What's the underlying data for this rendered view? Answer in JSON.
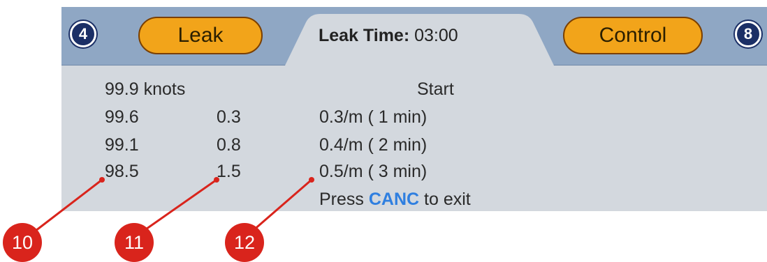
{
  "header": {
    "left_badge": "4",
    "right_badge": "8",
    "left_button": "Leak",
    "right_button": "Control",
    "leak_time_label": "Leak Time:",
    "leak_time_value": "03:00"
  },
  "rows": [
    {
      "speed": "99.9 knots",
      "diff": "",
      "rate": "Start"
    },
    {
      "speed": "99.6",
      "diff": "0.3",
      "rate": "0.3/m ( 1 min)"
    },
    {
      "speed": "99.1",
      "diff": "0.8",
      "rate": "0.4/m ( 2 min)"
    },
    {
      "speed": "98.5",
      "diff": "1.5",
      "rate": "0.5/m ( 3 min)"
    }
  ],
  "footer": {
    "prefix": "Press",
    "key": "CANC",
    "suffix": "to exit"
  },
  "callouts": [
    "10",
    "11",
    "12"
  ],
  "colors": {
    "header_band": "#8fa7c4",
    "panel": "#d3d8de",
    "button_fill": "#f2a41a",
    "callout": "#d9241c",
    "key_text": "#2f7fe0"
  }
}
